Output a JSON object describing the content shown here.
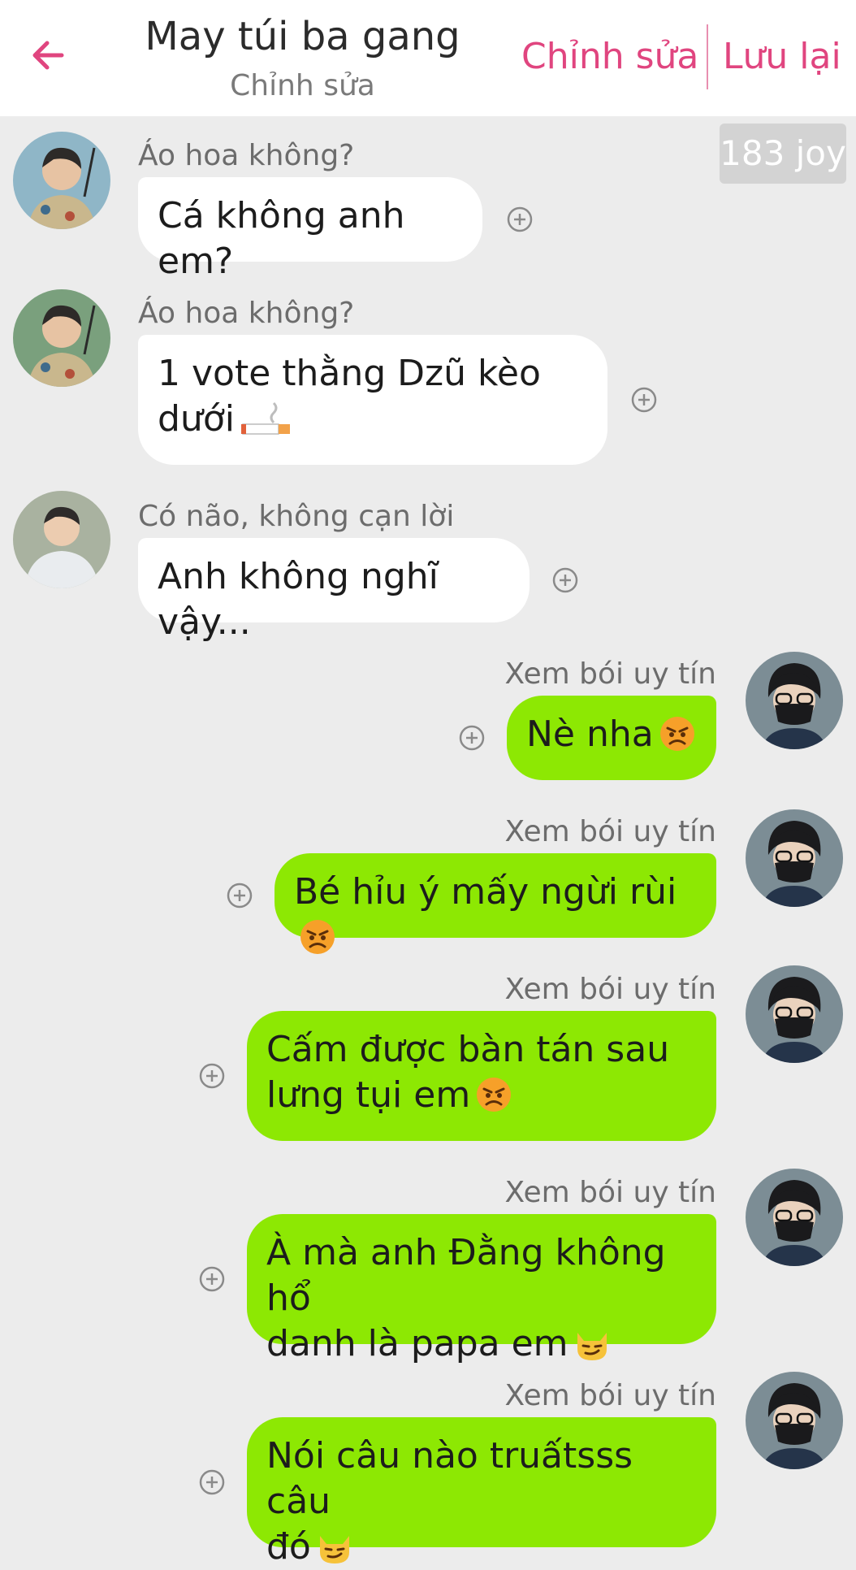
{
  "header": {
    "title": "May túi ba gang",
    "subtitle": "Chỉnh sửa",
    "edit_label": "Chỉnh sửa",
    "save_label": "Lưu lại",
    "accent_color": "#e0457f"
  },
  "badge": {
    "joy": "183 joy"
  },
  "messages": [
    {
      "side": "left",
      "sender": "Áo hoa không?",
      "lines": [
        "Cá không anh em?"
      ]
    },
    {
      "side": "left",
      "sender": "Áo hoa không?",
      "lines": [
        "1 vote thằng Dzũ kèo",
        "dưới"
      ],
      "emoji": "cigarette"
    },
    {
      "side": "left",
      "sender": "Có não, không cạn lời",
      "lines": [
        "Anh không nghĩ vậy..."
      ]
    },
    {
      "side": "right",
      "sender": "Xem bói uy tín",
      "lines": [
        "Nè nha"
      ],
      "emoji": "angry-face"
    },
    {
      "side": "right",
      "sender": "Xem bói uy tín",
      "lines": [
        "Bé hỉu ý mấy ngừi rùi"
      ],
      "emoji": "angry-face"
    },
    {
      "side": "right",
      "sender": "Xem bói uy tín",
      "lines": [
        "Cấm được bàn tán sau",
        "lưng tụi em"
      ],
      "emoji": "angry-face"
    },
    {
      "side": "right",
      "sender": "Xem bói uy tín",
      "lines": [
        "À mà anh Đằng không hổ",
        "danh là papa em"
      ],
      "emoji": "smirking-cat"
    },
    {
      "side": "right",
      "sender": "Xem bói uy tín",
      "lines": [
        "Nói câu nào truấtsss câu",
        "đó"
      ],
      "emoji": "smirking-cat"
    }
  ],
  "colors": {
    "background": "#ececec",
    "left_bubble": "#ffffff",
    "right_bubble": "#8de803"
  }
}
